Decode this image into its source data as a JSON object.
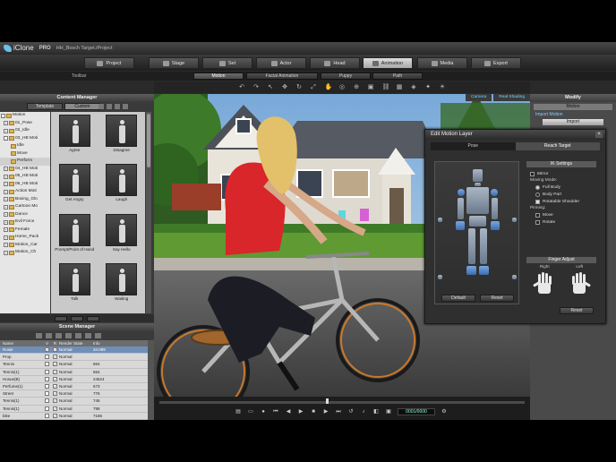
{
  "app": {
    "logo_text": "iClone",
    "edition": "PRO",
    "document_title": "HH_Bosch Target.iProject"
  },
  "module_tabs": [
    {
      "label": "Project",
      "icon": "project-icon",
      "active": false
    },
    {
      "label": "Stage",
      "icon": "stage-icon",
      "active": false
    },
    {
      "label": "Set",
      "icon": "set-icon",
      "active": false
    },
    {
      "label": "Actor",
      "icon": "actor-icon",
      "active": false
    },
    {
      "label": "Head",
      "icon": "head-icon",
      "active": false
    },
    {
      "label": "Animation",
      "icon": "animation-icon",
      "active": true
    },
    {
      "label": "Media",
      "icon": "media-icon",
      "active": false
    },
    {
      "label": "Export",
      "icon": "export-icon",
      "active": false
    }
  ],
  "sub_tabs": {
    "label": "Toolbar",
    "items": [
      {
        "label": "Motion",
        "active": true
      },
      {
        "label": "Facial Animation",
        "active": false
      },
      {
        "label": "Puppy",
        "active": false
      },
      {
        "label": "Path",
        "active": false
      }
    ]
  },
  "content_manager": {
    "title": "Content Manager",
    "tabs": [
      {
        "label": "Template",
        "active": false
      },
      {
        "label": "Custom",
        "active": true
      }
    ],
    "tree": [
      {
        "label": "Motion",
        "level": 0,
        "expanded": true
      },
      {
        "label": "01_Pose",
        "level": 1
      },
      {
        "label": "02_Idle",
        "level": 1
      },
      {
        "label": "03_HB Moti",
        "level": 1
      },
      {
        "label": "Idle",
        "level": 2
      },
      {
        "label": "Move",
        "level": 2
      },
      {
        "label": "Perform",
        "level": 2,
        "selected": true
      },
      {
        "label": "04_HB Moti",
        "level": 1
      },
      {
        "label": "05_HB Moti",
        "level": 1
      },
      {
        "label": "06_HB Moti",
        "level": 1
      },
      {
        "label": "Action Moti",
        "level": 1
      },
      {
        "label": "Boxing_Glo",
        "level": 1
      },
      {
        "label": "Cartoon Mo",
        "level": 1
      },
      {
        "label": "Dance",
        "level": 1
      },
      {
        "label": "Evil Force",
        "level": 1
      },
      {
        "label": "Female",
        "level": 1
      },
      {
        "label": "Home_Pack",
        "level": 1
      },
      {
        "label": "Motion_Car",
        "level": 1
      },
      {
        "label": "Motion_Ch",
        "level": 1
      }
    ],
    "items": [
      {
        "label": "Agree"
      },
      {
        "label": "Disagree"
      },
      {
        "label": "Get Angry"
      },
      {
        "label": "Laugh"
      },
      {
        "label": "Prompt/Point of Hand"
      },
      {
        "label": "Say Hello"
      },
      {
        "label": "Talk"
      },
      {
        "label": "Waiting"
      }
    ]
  },
  "scene_manager": {
    "title": "Scene Manager",
    "columns": [
      "Name",
      "V",
      "R",
      "Render State",
      "Info"
    ],
    "rows": [
      {
        "name": "Rosie",
        "v": true,
        "r": true,
        "state": "Normal",
        "info": "34.089",
        "selected": true
      },
      {
        "name": "Prop",
        "v": false,
        "r": true,
        "state": "Normal",
        "info": ""
      },
      {
        "name": "Tennis",
        "v": false,
        "r": true,
        "state": "Normal",
        "info": "564"
      },
      {
        "name": "Tennis(1)",
        "v": false,
        "r": true,
        "state": "Normal",
        "info": "564"
      },
      {
        "name": "Hosue(B)",
        "v": false,
        "r": true,
        "state": "Normal",
        "info": "24624"
      },
      {
        "name": "Perfume(1)",
        "v": false,
        "r": true,
        "state": "Normal",
        "info": "573"
      },
      {
        "name": "Street",
        "v": false,
        "r": true,
        "state": "Normal",
        "info": "776"
      },
      {
        "name": "Tennis(1)",
        "v": false,
        "r": true,
        "state": "Normal",
        "info": "746"
      },
      {
        "name": "Tennis(1)",
        "v": false,
        "r": true,
        "state": "Normal",
        "info": "798"
      },
      {
        "name": "bike",
        "v": false,
        "r": true,
        "state": "Normal",
        "info": "7186"
      }
    ]
  },
  "viewport": {
    "top_buttons": [
      "Camera",
      "Real Shading"
    ],
    "scene": "woman riding bicycle in front of a suburban house"
  },
  "timeline": {
    "frame": "0001/0000"
  },
  "modify_panel": {
    "title": "Modify",
    "sub_title": "Motion",
    "link_label": "Import Motion",
    "button": "Import"
  },
  "dialog": {
    "title": "Edit Motion Layer",
    "tabs": [
      {
        "label": "Pose",
        "active": false
      },
      {
        "label": "Reach Target",
        "active": true
      }
    ],
    "ik_settings": {
      "title": "IK Settings",
      "mirror_label": "Mirror",
      "moving_mode_label": "Moving Mode:",
      "modes": [
        {
          "label": "Full Body",
          "selected": true
        },
        {
          "label": "Body Part",
          "selected": false
        }
      ],
      "rotate_shoulder_label": "Rotatable Shoulder",
      "rotate_shoulder_checked": true,
      "pinning_label": "Pinning:",
      "pinning_options": [
        "Move",
        "Rotate"
      ]
    },
    "finger_adjust": {
      "title": "Finger Adjust",
      "right_label": "Right",
      "left_label": "Left",
      "reset_label": "Reset"
    },
    "buttons": {
      "default": "Default",
      "reset": "Reset"
    }
  }
}
